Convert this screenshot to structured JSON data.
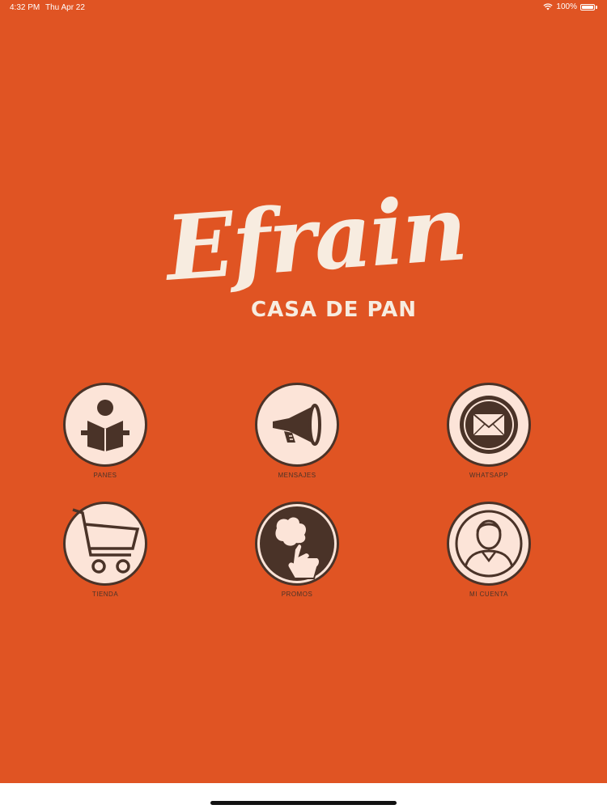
{
  "status_bar": {
    "time": "4:32 PM",
    "date": "Thu Apr 22",
    "battery": "100%"
  },
  "logo": {
    "script_text": "Efrain",
    "subtitle": "CASA DE PAN"
  },
  "menu": [
    {
      "label": "PANES",
      "icon": "reading-person-icon"
    },
    {
      "label": "MENSAJES",
      "icon": "megaphone-icon"
    },
    {
      "label": "WHATSAPP",
      "icon": "envelope-icon"
    },
    {
      "label": "TIENDA",
      "icon": "shopping-cart-icon"
    },
    {
      "label": "PROMOS",
      "icon": "hand-tap-icon"
    },
    {
      "label": "MI CUENTA",
      "icon": "user-account-icon"
    }
  ],
  "colors": {
    "background": "#e05423",
    "circle_fill": "#fce4d8",
    "icon_dark": "#4a3328",
    "logo_cream": "#f7ece0"
  }
}
